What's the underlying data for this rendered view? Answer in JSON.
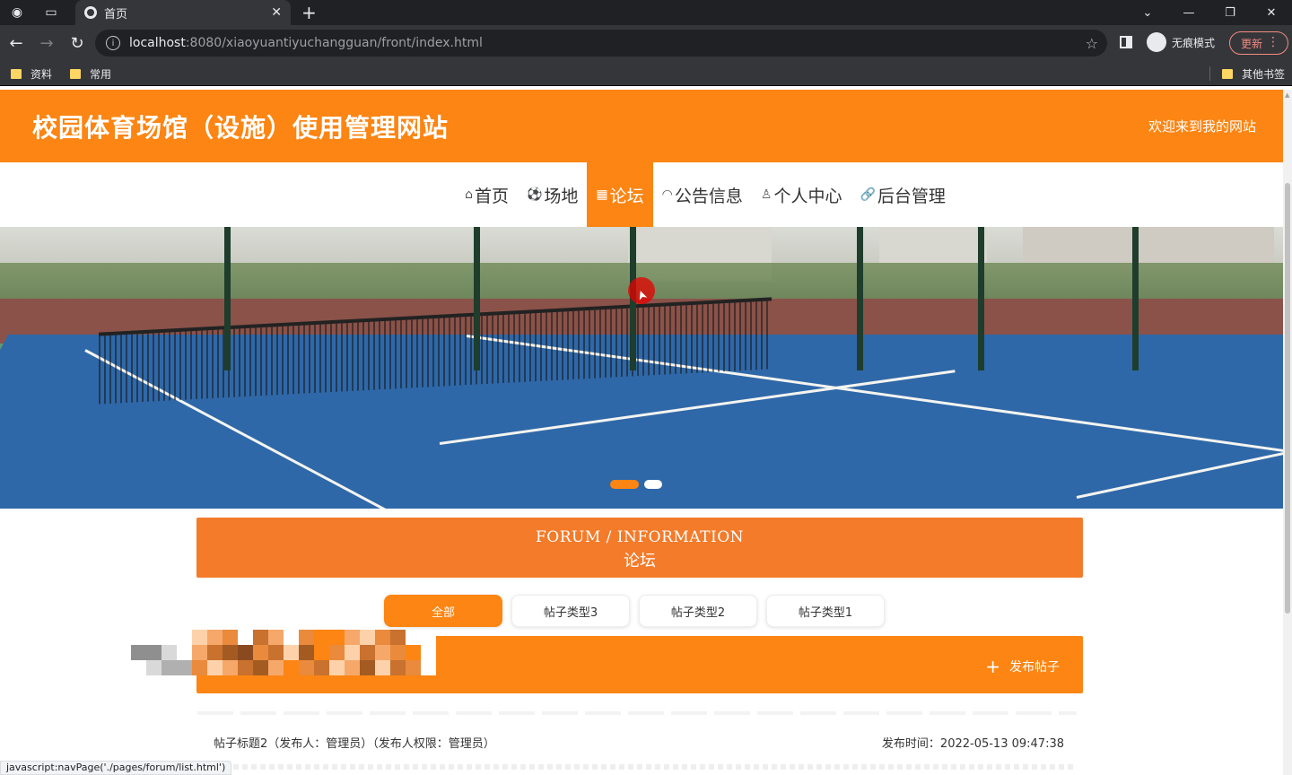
{
  "browser": {
    "tab_title": "首页",
    "url_host": "localhost",
    "url_path": ":8080/xiaoyuantiyuchangguan/front/index.html",
    "incognito_label": "无痕模式",
    "update_label": "更新",
    "bookmarks": [
      "资料",
      "常用"
    ],
    "other_bookmarks": "其他书签",
    "status_url": "javascript:navPage('./pages/forum/list.html')"
  },
  "site": {
    "title": "校园体育场馆（设施）使用管理网站",
    "welcome": "欢迎来到我的网站"
  },
  "nav": [
    {
      "icon": "home-icon",
      "label": "首页"
    },
    {
      "icon": "ball-icon",
      "label": "场地"
    },
    {
      "icon": "forum-icon",
      "label": "论坛",
      "active": true
    },
    {
      "icon": "notice-icon",
      "label": "公告信息"
    },
    {
      "icon": "user-icon",
      "label": "个人中心"
    },
    {
      "icon": "link-icon",
      "label": "后台管理"
    }
  ],
  "carousel": {
    "slides": 2,
    "active_index": 0
  },
  "forum": {
    "heading_en": "FORUM / INFORMATION",
    "heading_zh": "论坛",
    "filters": [
      "全部",
      "帖子类型3",
      "帖子类型2",
      "帖子类型1"
    ],
    "publish_label": "发布帖子",
    "posts": [
      {
        "title": "帖子标题2（发布人：管理员）（发布人权限：管理员）",
        "time": "发布时间：2022-05-13 09:47:38"
      }
    ]
  },
  "colors": {
    "accent": "#fc8513",
    "forum_header": "#f37b2a"
  }
}
